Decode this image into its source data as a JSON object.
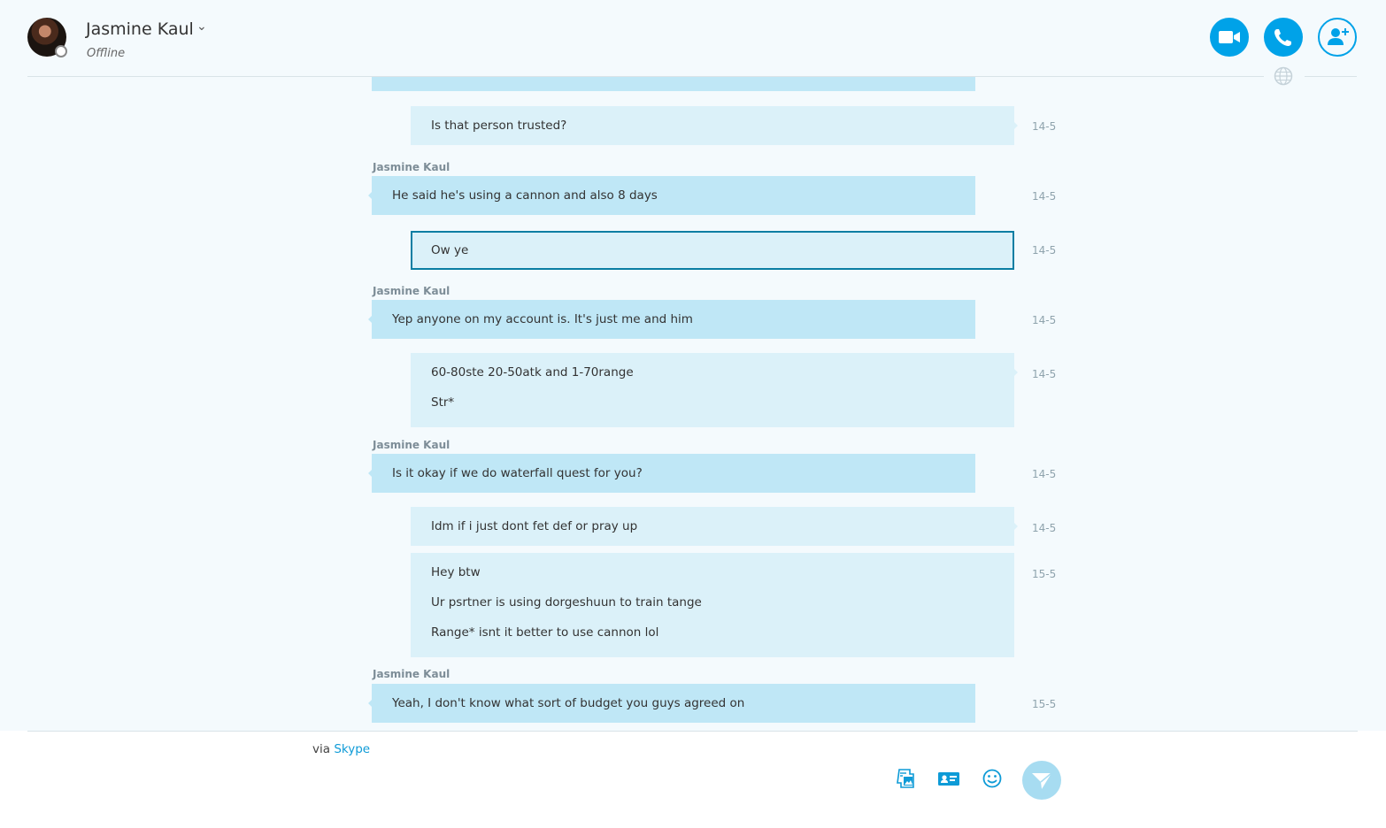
{
  "header": {
    "contact_name": "Jasmine Kaul",
    "status": "Offline",
    "icons": [
      "video-call-icon",
      "audio-call-icon",
      "add-people-icon",
      "translate-globe-icon",
      "chevron-down-icon"
    ]
  },
  "messages": [
    {
      "from": "Jasmine Kaul",
      "lines": [
        ""
      ],
      "time": ""
    },
    {
      "from": "me",
      "lines": [
        "Is that person trusted?"
      ],
      "time": "14-5"
    },
    {
      "from": "Jasmine Kaul",
      "sender_label": "Jasmine Kaul",
      "lines": [
        "He said he's using a cannon and also 8 days"
      ],
      "time": "14-5"
    },
    {
      "from": "me",
      "lines": [
        "Ow ye"
      ],
      "time": "14-5",
      "selected": true
    },
    {
      "from": "Jasmine Kaul",
      "sender_label": "Jasmine Kaul",
      "lines": [
        "Yep anyone on my account is. It's just me and him"
      ],
      "time": "14-5"
    },
    {
      "from": "me",
      "lines": [
        "60-80ste 20-50atk and 1-70range",
        "Str*"
      ],
      "time": "14-5"
    },
    {
      "from": "Jasmine Kaul",
      "sender_label": "Jasmine Kaul",
      "lines": [
        "Is it okay if we do waterfall quest for you?"
      ],
      "time": "14-5"
    },
    {
      "from": "me",
      "lines": [
        "Idm if i just dont fet def or pray up"
      ],
      "time": "14-5"
    },
    {
      "from": "me",
      "lines": [
        "Hey btw",
        "Ur psrtner is using dorgeshuun to train tange",
        "Range* isnt it better to use cannon lol"
      ],
      "time": "15-5"
    },
    {
      "from": "Jasmine Kaul",
      "sender_label": "Jasmine Kaul",
      "lines": [
        "Yeah, I don't know what sort of budget you guys agreed on"
      ],
      "time": "15-5"
    }
  ],
  "footer": {
    "via_prefix": "via",
    "via_link": "Skype",
    "icons": [
      "send-image-icon",
      "send-contact-icon",
      "emoticon-icon",
      "send-icon"
    ]
  },
  "colors": {
    "accent": "#00a2e8",
    "their_bubble": "#bfe7f6",
    "my_bubble": "#dbf1f9",
    "selected_border": "#0a7ea3",
    "background": "#f4fafd"
  }
}
